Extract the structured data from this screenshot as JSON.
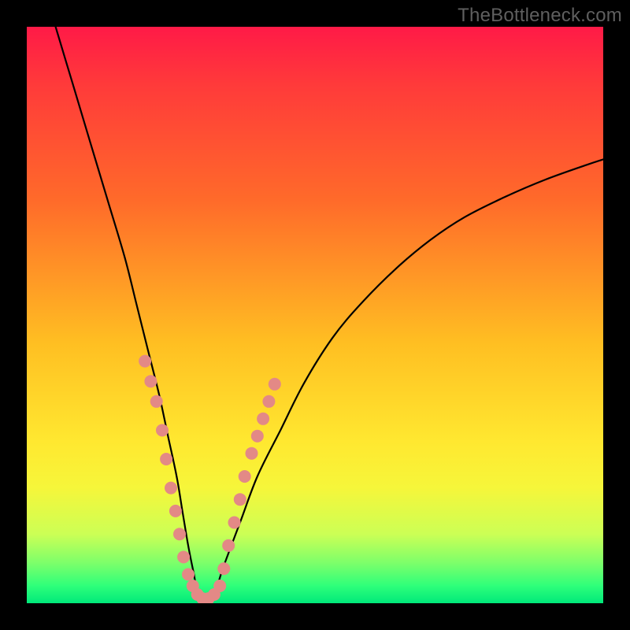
{
  "watermark": "TheBottleneck.com",
  "chart_data": {
    "type": "line",
    "title": "",
    "xlabel": "",
    "ylabel": "",
    "xlim": [
      0,
      100
    ],
    "ylim": [
      0,
      100
    ],
    "grid": false,
    "legend": false,
    "annotations": [],
    "series": [
      {
        "name": "bottleneck-curve",
        "color": "#000000",
        "x": [
          5,
          8,
          11,
          14,
          17,
          19,
          21,
          23,
          24.5,
          26,
          27,
          28,
          29,
          30,
          32,
          34,
          37,
          40,
          44,
          48,
          53,
          58,
          64,
          70,
          76,
          83,
          90,
          97,
          100
        ],
        "values": [
          100,
          90,
          80,
          70,
          60,
          52,
          44,
          36,
          29,
          22,
          16,
          10,
          5,
          0,
          0,
          6,
          14,
          22,
          30,
          38,
          46,
          52,
          58,
          63,
          67,
          70.5,
          73.5,
          76,
          77
        ]
      }
    ],
    "dots": {
      "color": "#e38986",
      "radius_px": 8,
      "points": [
        {
          "x": 20.5,
          "y": 42
        },
        {
          "x": 21.5,
          "y": 38.5
        },
        {
          "x": 22.5,
          "y": 35
        },
        {
          "x": 23.5,
          "y": 30
        },
        {
          "x": 24.2,
          "y": 25
        },
        {
          "x": 25.0,
          "y": 20
        },
        {
          "x": 25.8,
          "y": 16
        },
        {
          "x": 26.5,
          "y": 12
        },
        {
          "x": 27.2,
          "y": 8
        },
        {
          "x": 28.0,
          "y": 5
        },
        {
          "x": 28.8,
          "y": 3
        },
        {
          "x": 29.6,
          "y": 1.5
        },
        {
          "x": 30.5,
          "y": 0.8
        },
        {
          "x": 31.5,
          "y": 0.8
        },
        {
          "x": 32.5,
          "y": 1.5
        },
        {
          "x": 33.5,
          "y": 3
        },
        {
          "x": 34.2,
          "y": 6
        },
        {
          "x": 35.0,
          "y": 10
        },
        {
          "x": 36.0,
          "y": 14
        },
        {
          "x": 37.0,
          "y": 18
        },
        {
          "x": 37.8,
          "y": 22
        },
        {
          "x": 39.0,
          "y": 26
        },
        {
          "x": 40.0,
          "y": 29
        },
        {
          "x": 41.0,
          "y": 32
        },
        {
          "x": 42.0,
          "y": 35
        },
        {
          "x": 43.0,
          "y": 38
        }
      ]
    }
  }
}
